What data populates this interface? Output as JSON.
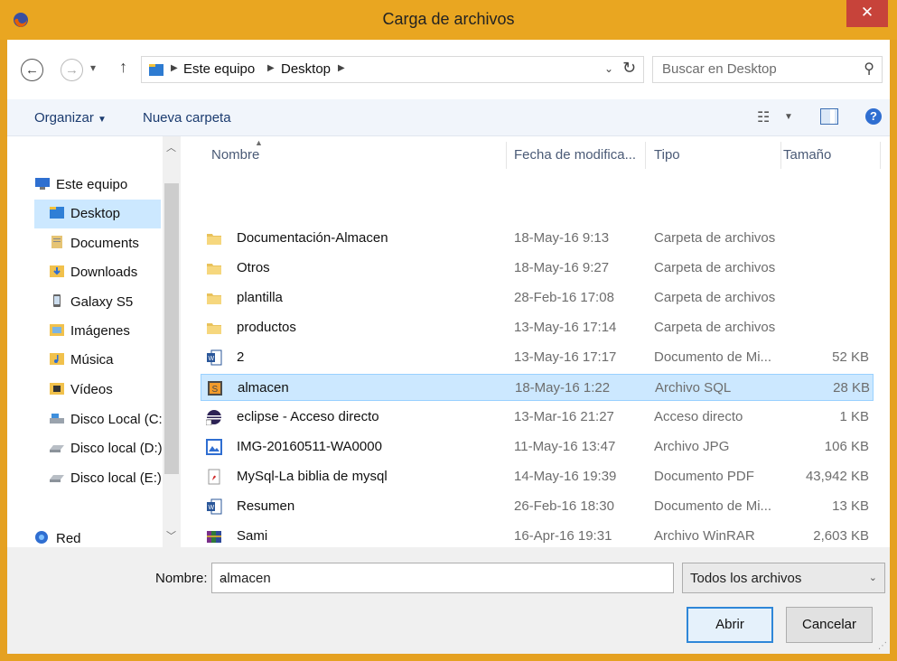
{
  "window": {
    "title": "Carga de archivos",
    "close_label": "✕"
  },
  "address": {
    "crumbs": [
      "Este equipo",
      "Desktop"
    ],
    "search_placeholder": "Buscar en Desktop"
  },
  "toolbar": {
    "organize": "Organizar",
    "new_folder": "Nueva carpeta",
    "help": "?"
  },
  "nav": {
    "items": [
      {
        "label": "Este equipo",
        "icon": "computer-icon"
      },
      {
        "label": "Desktop",
        "icon": "desktop-folder-icon",
        "selected": true
      },
      {
        "label": "Documents",
        "icon": "documents-icon"
      },
      {
        "label": "Downloads",
        "icon": "downloads-icon"
      },
      {
        "label": "Galaxy S5",
        "icon": "phone-icon"
      },
      {
        "label": "Imágenes",
        "icon": "pictures-icon"
      },
      {
        "label": "Música",
        "icon": "music-icon"
      },
      {
        "label": "Vídeos",
        "icon": "videos-icon"
      },
      {
        "label": "Disco Local (C:)",
        "icon": "drive-icon"
      },
      {
        "label": "Disco local (D:)",
        "icon": "drive-icon"
      },
      {
        "label": "Disco local (E:)",
        "icon": "drive-icon"
      },
      {
        "label": "Red",
        "icon": "network-icon"
      }
    ]
  },
  "columns": {
    "name": "Nombre",
    "date": "Fecha de modifica...",
    "type": "Tipo",
    "size": "Tamaño"
  },
  "files": [
    {
      "name": "Documentación-Almacen",
      "date": "18-May-16 9:13",
      "type": "Carpeta de archivos",
      "size": "",
      "icon": "folder-icon"
    },
    {
      "name": "Otros",
      "date": "18-May-16 9:27",
      "type": "Carpeta de archivos",
      "size": "",
      "icon": "folder-icon"
    },
    {
      "name": "plantilla",
      "date": "28-Feb-16 17:08",
      "type": "Carpeta de archivos",
      "size": "",
      "icon": "folder-icon"
    },
    {
      "name": "productos",
      "date": "13-May-16 17:14",
      "type": "Carpeta de archivos",
      "size": "",
      "icon": "folder-icon"
    },
    {
      "name": "2",
      "date": "13-May-16 17:17",
      "type": "Documento de Mi...",
      "size": "52 KB",
      "icon": "word-doc-icon"
    },
    {
      "name": "almacen",
      "date": "18-May-16 1:22",
      "type": "Archivo SQL",
      "size": "28 KB",
      "icon": "sql-file-icon",
      "selected": true
    },
    {
      "name": "eclipse - Acceso directo",
      "date": "13-Mar-16 21:27",
      "type": "Acceso directo",
      "size": "1 KB",
      "icon": "eclipse-shortcut-icon"
    },
    {
      "name": "IMG-20160511-WA0000",
      "date": "11-May-16 13:47",
      "type": "Archivo JPG",
      "size": "106 KB",
      "icon": "image-file-icon"
    },
    {
      "name": "MySql-La biblia de mysql",
      "date": "14-May-16 19:39",
      "type": "Documento PDF",
      "size": "43,942 KB",
      "icon": "pdf-file-icon"
    },
    {
      "name": "Resumen",
      "date": "26-Feb-16 18:30",
      "type": "Documento de Mi...",
      "size": "13 KB",
      "icon": "word-doc-icon"
    },
    {
      "name": "Sami",
      "date": "16-Apr-16 19:31",
      "type": "Archivo WinRAR",
      "size": "2,603 KB",
      "icon": "winrar-archive-icon"
    }
  ],
  "footer": {
    "filename_label": "Nombre:",
    "filename_value": "almacen",
    "filter_value": "Todos los archivos",
    "open_label": "Abrir",
    "cancel_label": "Cancelar"
  },
  "colors": {
    "title_bar": "#e9a621",
    "close": "#c7433a",
    "selection": "#cce8ff",
    "link_text": "#1b3b6f"
  }
}
